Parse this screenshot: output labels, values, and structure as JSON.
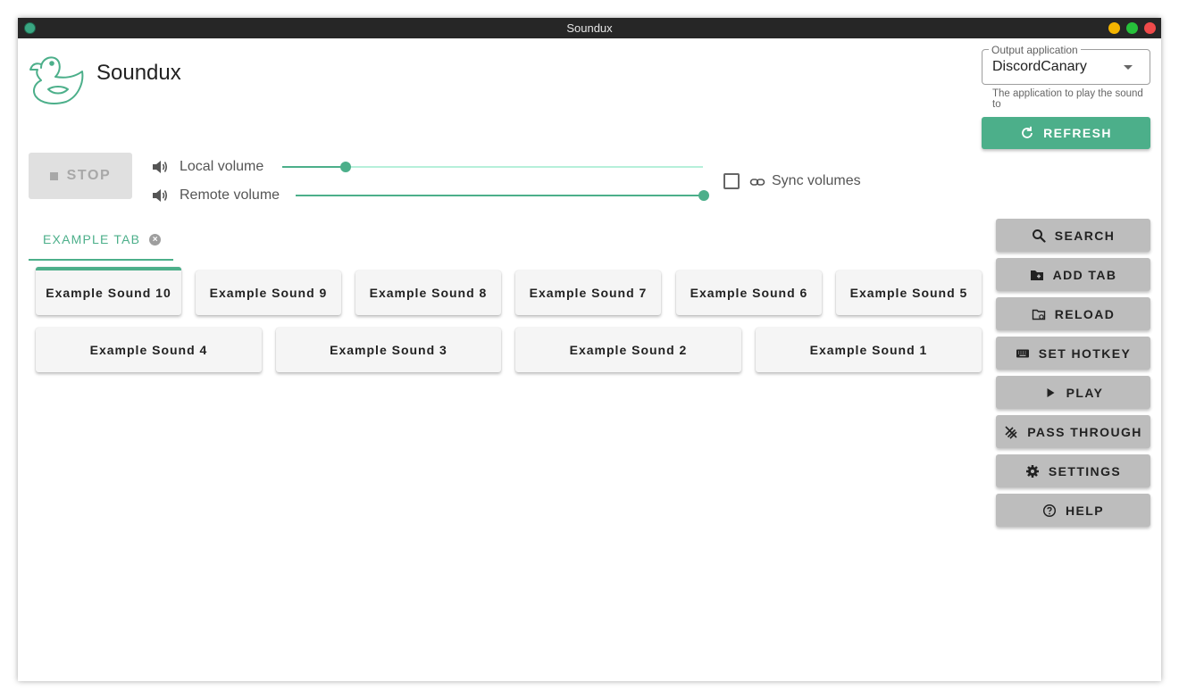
{
  "window": {
    "title": "Soundux"
  },
  "app": {
    "name": "Soundux"
  },
  "output": {
    "legend": "Output application",
    "value": "DiscordCanary",
    "hint": "The application to play the sound to",
    "refresh_label": "REFRESH"
  },
  "controls": {
    "stop_label": "STOP",
    "local_volume_label": "Local volume",
    "remote_volume_label": "Remote volume",
    "local_volume_fraction": 0.15,
    "remote_volume_fraction": 1.0,
    "sync_label": "Sync volumes",
    "sync_checked": false
  },
  "tabs": [
    {
      "label": "EXAMPLE TAB"
    }
  ],
  "sounds": [
    "Example Sound 10",
    "Example Sound 9",
    "Example Sound 8",
    "Example Sound 7",
    "Example Sound 6",
    "Example Sound 5",
    "Example Sound 4",
    "Example Sound 3",
    "Example Sound 2",
    "Example Sound 1"
  ],
  "sidebar": [
    {
      "label": "SEARCH",
      "icon": "search-icon"
    },
    {
      "label": "ADD TAB",
      "icon": "folder-plus-icon"
    },
    {
      "label": "RELOAD",
      "icon": "folder-refresh-icon"
    },
    {
      "label": "SET HOTKEY",
      "icon": "keyboard-icon"
    },
    {
      "label": "PLAY",
      "icon": "play-icon"
    },
    {
      "label": "PASS THROUGH",
      "icon": "pass-through-icon"
    },
    {
      "label": "SETTINGS",
      "icon": "gear-icon"
    },
    {
      "label": "HELP",
      "icon": "help-icon"
    }
  ],
  "colors": {
    "accent": "#4caf8a",
    "titlebar": "#262626",
    "side_button": "#bdbdbd"
  }
}
